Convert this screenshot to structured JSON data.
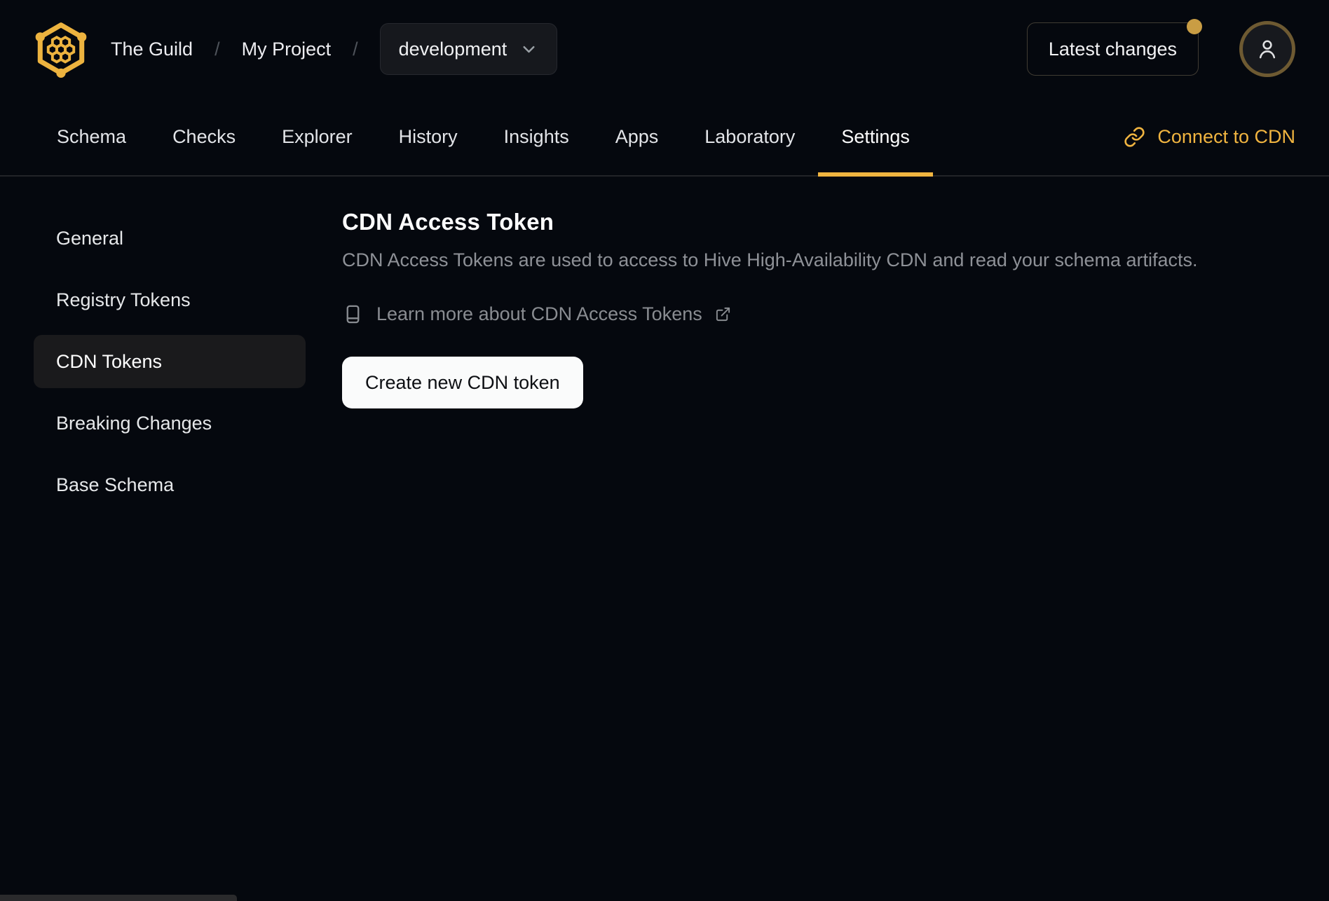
{
  "header": {
    "breadcrumb": {
      "org": "The Guild",
      "separator": "/",
      "project": "My Project"
    },
    "target_selector": {
      "value": "development",
      "chevron_icon": "chevron-down-icon"
    },
    "latest_changes_label": "Latest changes",
    "notification_dot": true,
    "avatar_icon": "user-icon",
    "logo_icon": "hive-honeycomb-logo"
  },
  "tabs": {
    "items": [
      {
        "label": "Schema",
        "active": false
      },
      {
        "label": "Checks",
        "active": false
      },
      {
        "label": "Explorer",
        "active": false
      },
      {
        "label": "History",
        "active": false
      },
      {
        "label": "Insights",
        "active": false
      },
      {
        "label": "Apps",
        "active": false
      },
      {
        "label": "Laboratory",
        "active": false
      },
      {
        "label": "Settings",
        "active": true
      }
    ],
    "connect_cdn": {
      "label": "Connect to CDN",
      "icon": "link-icon"
    }
  },
  "sidebar": {
    "items": [
      {
        "label": "General",
        "active": false
      },
      {
        "label": "Registry Tokens",
        "active": false
      },
      {
        "label": "CDN Tokens",
        "active": true
      },
      {
        "label": "Breaking Changes",
        "active": false
      },
      {
        "label": "Base Schema",
        "active": false
      }
    ]
  },
  "main": {
    "title": "CDN Access Token",
    "description": "CDN Access Tokens are used to access to Hive High-Availability CDN and read your schema artifacts.",
    "learn_more": {
      "label": "Learn more about CDN Access Tokens",
      "book_icon": "book-icon",
      "external_icon": "external-link-icon"
    },
    "create_button_label": "Create new CDN token"
  },
  "colors": {
    "accent_gold": "#f0b440",
    "background": "#05080e",
    "surface": "#16181d",
    "sidebar_active": "#1a1a1c",
    "notification_dot": "#c99d44",
    "avatar_ring": "#6e5a32",
    "muted_text": "#8e9197",
    "cta_background": "#fafbfb"
  }
}
